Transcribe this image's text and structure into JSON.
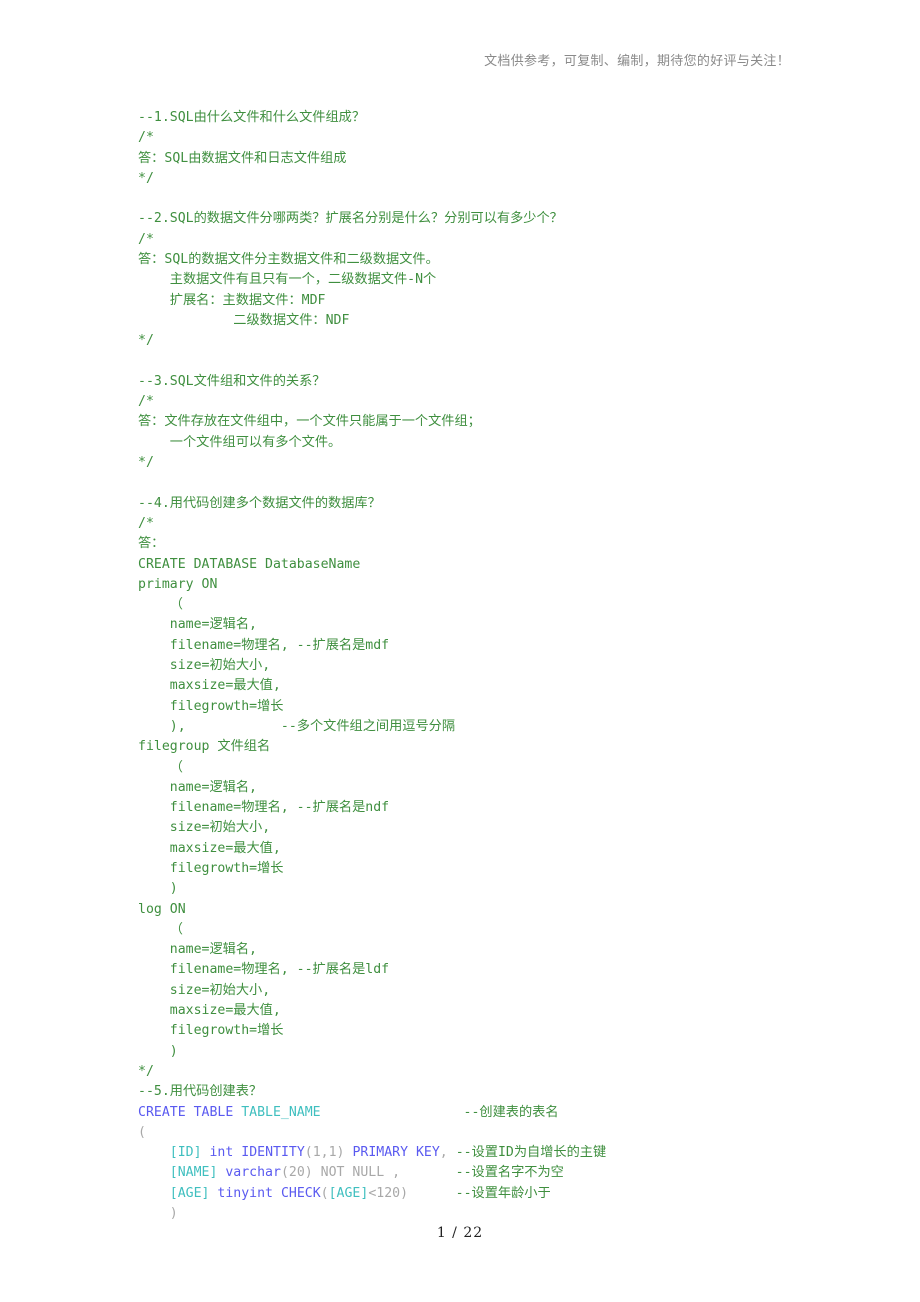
{
  "document": {
    "header_note": "文档供参考，可复制、编制，期待您的好评与关注！",
    "footer": "1 / 22"
  },
  "colors": {
    "comment_green": "#3f8f3f",
    "keyword_blue": "#5a5af0",
    "identifier_teal": "#3fbfbf",
    "muted_gray": "#a8a8a8",
    "header_gray": "#8a8a8a",
    "footer_black": "#222222",
    "background": "#ffffff"
  },
  "lines": [
    {
      "id": "l1",
      "segments": [
        {
          "text": "--1.SQL由什么文件和什么文件组成？",
          "color": "green"
        }
      ]
    },
    {
      "id": "l2",
      "segments": [
        {
          "text": "/*",
          "color": "green"
        }
      ]
    },
    {
      "id": "l3",
      "segments": [
        {
          "text": "答：SQL由数据文件和日志文件组成",
          "color": "green"
        }
      ]
    },
    {
      "id": "l4",
      "segments": [
        {
          "text": "*/",
          "color": "green"
        }
      ]
    },
    {
      "id": "l5",
      "segments": [
        {
          "text": "",
          "color": "green"
        }
      ]
    },
    {
      "id": "l6",
      "segments": [
        {
          "text": "--2.SQL的数据文件分哪两类？扩展名分别是什么？分别可以有多少个？",
          "color": "green"
        }
      ]
    },
    {
      "id": "l7",
      "segments": [
        {
          "text": "/*",
          "color": "green"
        }
      ]
    },
    {
      "id": "l8",
      "segments": [
        {
          "text": "答：SQL的数据文件分主数据文件和二级数据文件。",
          "color": "green"
        }
      ]
    },
    {
      "id": "l9",
      "segments": [
        {
          "text": "    主数据文件有且只有一个，二级数据文件-N个",
          "color": "green"
        }
      ]
    },
    {
      "id": "l10",
      "segments": [
        {
          "text": "    扩展名：主数据文件：MDF",
          "color": "green"
        }
      ]
    },
    {
      "id": "l11",
      "segments": [
        {
          "text": "            二级数据文件：NDF",
          "color": "green"
        }
      ]
    },
    {
      "id": "l12",
      "segments": [
        {
          "text": "*/",
          "color": "green"
        }
      ]
    },
    {
      "id": "l13",
      "segments": [
        {
          "text": "",
          "color": "green"
        }
      ]
    },
    {
      "id": "l14",
      "segments": [
        {
          "text": "--3.SQL文件组和文件的关系？",
          "color": "green"
        }
      ]
    },
    {
      "id": "l15",
      "segments": [
        {
          "text": "/*",
          "color": "green"
        }
      ]
    },
    {
      "id": "l16",
      "segments": [
        {
          "text": "答：文件存放在文件组中，一个文件只能属于一个文件组；",
          "color": "green"
        }
      ]
    },
    {
      "id": "l17",
      "segments": [
        {
          "text": "    一个文件组可以有多个文件。",
          "color": "green"
        }
      ]
    },
    {
      "id": "l18",
      "segments": [
        {
          "text": "*/",
          "color": "green"
        }
      ]
    },
    {
      "id": "l19",
      "segments": [
        {
          "text": "",
          "color": "green"
        }
      ]
    },
    {
      "id": "l20",
      "segments": [
        {
          "text": "--4.用代码创建多个数据文件的数据库？",
          "color": "green"
        }
      ]
    },
    {
      "id": "l21",
      "segments": [
        {
          "text": "/*",
          "color": "green"
        }
      ]
    },
    {
      "id": "l22",
      "segments": [
        {
          "text": "答：",
          "color": "green"
        }
      ]
    },
    {
      "id": "l23",
      "segments": [
        {
          "text": "CREATE DATABASE DatabaseName",
          "color": "green"
        }
      ]
    },
    {
      "id": "l24",
      "segments": [
        {
          "text": "primary ON",
          "color": "green"
        }
      ]
    },
    {
      "id": "l25",
      "segments": [
        {
          "text": "    （",
          "color": "green"
        }
      ]
    },
    {
      "id": "l26",
      "segments": [
        {
          "text": "    name=逻辑名,",
          "color": "green"
        }
      ]
    },
    {
      "id": "l27",
      "segments": [
        {
          "text": "    filename=物理名, --扩展名是mdf",
          "color": "green"
        }
      ]
    },
    {
      "id": "l28",
      "segments": [
        {
          "text": "    size=初始大小,",
          "color": "green"
        }
      ]
    },
    {
      "id": "l29",
      "segments": [
        {
          "text": "    maxsize=最大值,",
          "color": "green"
        }
      ]
    },
    {
      "id": "l30",
      "segments": [
        {
          "text": "    filegrowth=增长",
          "color": "green"
        }
      ]
    },
    {
      "id": "l31",
      "segments": [
        {
          "text": "    ),            --多个文件组之间用逗号分隔",
          "color": "green"
        }
      ]
    },
    {
      "id": "l32",
      "segments": [
        {
          "text": "filegroup 文件组名",
          "color": "green"
        }
      ]
    },
    {
      "id": "l33",
      "segments": [
        {
          "text": "    （",
          "color": "green"
        }
      ]
    },
    {
      "id": "l34",
      "segments": [
        {
          "text": "    name=逻辑名,",
          "color": "green"
        }
      ]
    },
    {
      "id": "l35",
      "segments": [
        {
          "text": "    filename=物理名, --扩展名是ndf",
          "color": "green"
        }
      ]
    },
    {
      "id": "l36",
      "segments": [
        {
          "text": "    size=初始大小,",
          "color": "green"
        }
      ]
    },
    {
      "id": "l37",
      "segments": [
        {
          "text": "    maxsize=最大值,",
          "color": "green"
        }
      ]
    },
    {
      "id": "l38",
      "segments": [
        {
          "text": "    filegrowth=增长",
          "color": "green"
        }
      ]
    },
    {
      "id": "l39",
      "segments": [
        {
          "text": "    )",
          "color": "green"
        }
      ]
    },
    {
      "id": "l40",
      "segments": [
        {
          "text": "log ON",
          "color": "green"
        }
      ]
    },
    {
      "id": "l41",
      "segments": [
        {
          "text": "    （",
          "color": "green"
        }
      ]
    },
    {
      "id": "l42",
      "segments": [
        {
          "text": "    name=逻辑名,",
          "color": "green"
        }
      ]
    },
    {
      "id": "l43",
      "segments": [
        {
          "text": "    filename=物理名, --扩展名是ldf",
          "color": "green"
        }
      ]
    },
    {
      "id": "l44",
      "segments": [
        {
          "text": "    size=初始大小,",
          "color": "green"
        }
      ]
    },
    {
      "id": "l45",
      "segments": [
        {
          "text": "    maxsize=最大值,",
          "color": "green"
        }
      ]
    },
    {
      "id": "l46",
      "segments": [
        {
          "text": "    filegrowth=增长",
          "color": "green"
        }
      ]
    },
    {
      "id": "l47",
      "segments": [
        {
          "text": "    )",
          "color": "green"
        }
      ]
    },
    {
      "id": "l48",
      "segments": [
        {
          "text": "*/",
          "color": "green"
        }
      ]
    },
    {
      "id": "l49",
      "segments": [
        {
          "text": "--5.用代码创建表？",
          "color": "green"
        }
      ]
    },
    {
      "id": "l50",
      "segments": [
        {
          "text": "CREATE TABLE ",
          "color": "blue"
        },
        {
          "text": "TABLE_NAME",
          "color": "teal"
        },
        {
          "text": "                  ",
          "color": "plain"
        },
        {
          "text": "--创建表的表名",
          "color": "green"
        }
      ]
    },
    {
      "id": "l51",
      "segments": [
        {
          "text": "(",
          "color": "gray"
        }
      ]
    },
    {
      "id": "l52",
      "segments": [
        {
          "text": "    ",
          "color": "plain"
        },
        {
          "text": "[ID]",
          "color": "teal"
        },
        {
          "text": " ",
          "color": "plain"
        },
        {
          "text": "int",
          "color": "blue"
        },
        {
          "text": " ",
          "color": "plain"
        },
        {
          "text": "IDENTITY",
          "color": "blue"
        },
        {
          "text": "(1,1)",
          "color": "gray"
        },
        {
          "text": " ",
          "color": "plain"
        },
        {
          "text": "PRIMARY KEY",
          "color": "blue"
        },
        {
          "text": ", ",
          "color": "gray"
        },
        {
          "text": "--设置ID为自增长的主键",
          "color": "green"
        }
      ]
    },
    {
      "id": "l53",
      "segments": [
        {
          "text": "    ",
          "color": "plain"
        },
        {
          "text": "[NAME]",
          "color": "teal"
        },
        {
          "text": " ",
          "color": "plain"
        },
        {
          "text": "varchar",
          "color": "blue"
        },
        {
          "text": "(20)",
          "color": "gray"
        },
        {
          "text": " ",
          "color": "plain"
        },
        {
          "text": "NOT NULL",
          "color": "gray"
        },
        {
          "text": " ,       ",
          "color": "gray"
        },
        {
          "text": "--设置名字不为空",
          "color": "green"
        }
      ]
    },
    {
      "id": "l54",
      "segments": [
        {
          "text": "    ",
          "color": "plain"
        },
        {
          "text": "[AGE]",
          "color": "teal"
        },
        {
          "text": " ",
          "color": "plain"
        },
        {
          "text": "tinyint",
          "color": "blue"
        },
        {
          "text": " ",
          "color": "plain"
        },
        {
          "text": "CHECK",
          "color": "blue"
        },
        {
          "text": "(",
          "color": "gray"
        },
        {
          "text": "[AGE]",
          "color": "teal"
        },
        {
          "text": "<120)",
          "color": "gray"
        },
        {
          "text": "      ",
          "color": "plain"
        },
        {
          "text": "--设置年龄小于",
          "color": "green"
        }
      ]
    },
    {
      "id": "l55",
      "segments": [
        {
          "text": "    )",
          "color": "gray"
        }
      ]
    }
  ]
}
